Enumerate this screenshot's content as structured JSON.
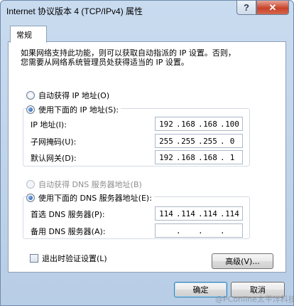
{
  "window": {
    "title": "Internet 协议版本 4 (TCP/IPv4) 属性",
    "help_label": "?",
    "close_label": "✕"
  },
  "tabs": [
    {
      "label": "常规",
      "selected": true
    }
  ],
  "description": {
    "line1": "如果网络支持此功能，则可以获取自动指派的 IP 设置。否则，",
    "line2": "您需要从网络系统管理员处获得适当的 IP 设置。"
  },
  "ip_section": {
    "auto_label": "自动获得 IP 地址(O)",
    "auto_selected": false,
    "manual_label": "使用下面的 IP 地址(S):",
    "manual_selected": true,
    "fields": [
      {
        "label": "IP 地址(I):",
        "octets": [
          "192",
          "168",
          "168",
          "100"
        ]
      },
      {
        "label": "子网掩码(U):",
        "octets": [
          "255",
          "255",
          "255",
          "0"
        ]
      },
      {
        "label": "默认网关(D):",
        "octets": [
          "192",
          "168",
          "168",
          "1"
        ]
      }
    ]
  },
  "dns_section": {
    "auto_label": "自动获得 DNS 服务器地址(B)",
    "auto_selected": false,
    "auto_disabled": true,
    "manual_label": "使用下面的 DNS 服务器地址(E):",
    "manual_selected": true,
    "fields": [
      {
        "label": "首选 DNS 服务器(P):",
        "octets": [
          "114",
          "114",
          "114",
          "114"
        ]
      },
      {
        "label": "备用 DNS 服务器(A):",
        "octets": [
          "",
          "",
          "",
          ""
        ]
      }
    ]
  },
  "validate_on_exit": {
    "label": "退出时验证设置(L)",
    "checked": false
  },
  "buttons": {
    "advanced": "高级(V)...",
    "ok": "确定",
    "cancel": "取消"
  },
  "watermark": "@PConline太平洋科技"
}
